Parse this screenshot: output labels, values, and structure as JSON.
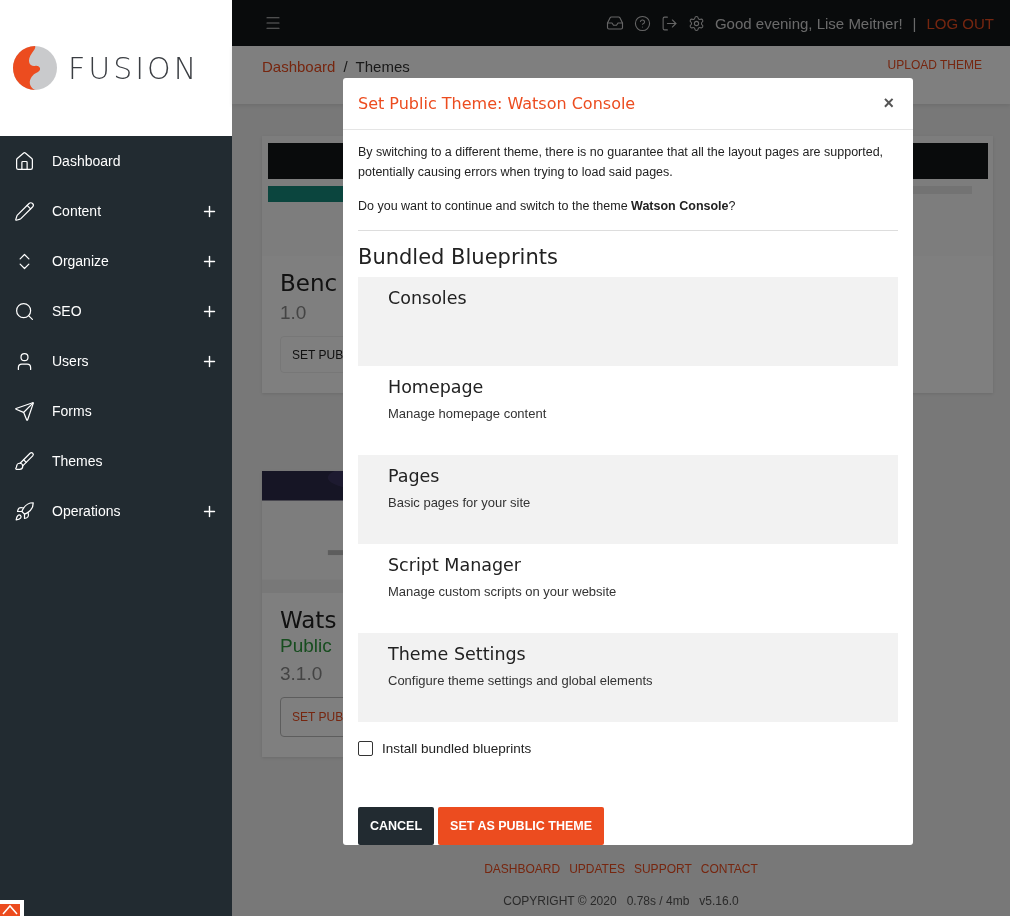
{
  "brand": {
    "name": "FUSION"
  },
  "sidebar": {
    "items": [
      {
        "label": "Dashboard",
        "expandable": false
      },
      {
        "label": "Content",
        "expandable": true
      },
      {
        "label": "Organize",
        "expandable": true
      },
      {
        "label": "SEO",
        "expandable": true
      },
      {
        "label": "Users",
        "expandable": true
      },
      {
        "label": "Forms",
        "expandable": false
      },
      {
        "label": "Themes",
        "expandable": false
      },
      {
        "label": "Operations",
        "expandable": true
      }
    ]
  },
  "topbar": {
    "greeting": "Good evening, Lise Meitner!",
    "separator": "|",
    "logout": "LOG OUT"
  },
  "breadcrumb": {
    "items": [
      "Dashboard",
      "Themes"
    ],
    "separator": "/",
    "action": "UPLOAD THEME"
  },
  "themes": [
    {
      "name": "Benc",
      "version": "1.0",
      "button": "SET PUB",
      "public": false
    },
    {
      "name": "Wats",
      "version": "3.1.0",
      "status": "Public",
      "button": "SET PUB",
      "public": true
    }
  ],
  "footer": {
    "links": [
      "DASHBOARD",
      "UPDATES",
      "SUPPORT",
      "CONTACT"
    ],
    "copyright": "COPYRIGHT © 2020",
    "timing": "0.78s / 4mb",
    "version": "v5.16.0"
  },
  "modal": {
    "title": "Set Public Theme: Watson Console",
    "close": "×",
    "warning": "By switching to a different theme, there is no guarantee that all the layout pages are supported, potentially causing errors when trying to load said pages.",
    "question": "Do you want to continue and switch to the theme **Watson Console**?",
    "blueprints_heading": "Bundled Blueprints",
    "blueprints": [
      {
        "name": "Consoles"
      },
      {
        "name": "Homepage",
        "description": "Manage homepage content"
      },
      {
        "name": "Pages",
        "description": "Basic pages for your site"
      },
      {
        "name": "Script Manager",
        "description": "Manage custom scripts on your website"
      },
      {
        "name": "Theme Settings",
        "description": "Configure theme settings and global elements"
      }
    ],
    "install": {
      "label": "Install bundled blueprints",
      "checked": false
    },
    "buttons": {
      "cancel": "CANCEL",
      "confirm": "SET AS PUBLIC THEME"
    }
  }
}
